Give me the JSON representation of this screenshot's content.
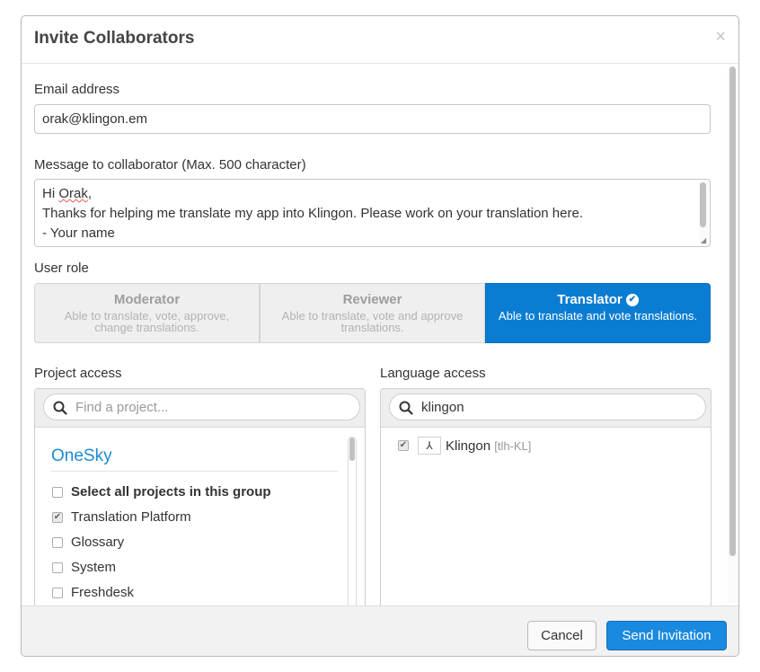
{
  "dialog": {
    "title": "Invite Collaborators",
    "close_glyph": "×"
  },
  "email": {
    "label": "Email address",
    "value": "orak@klingon.em"
  },
  "message": {
    "label": "Message to collaborator (Max. 500 character)",
    "line1_prefix": "Hi ",
    "line1_name": "Orak",
    "line1_suffix": ",",
    "line2": "Thanks for helping me translate my app into Klingon. Please work on your translation here.",
    "line3": "- Your name"
  },
  "user_role": {
    "label": "User role",
    "roles": [
      {
        "name": "Moderator",
        "desc": "Able to translate, vote, approve, change translations.",
        "selected": false
      },
      {
        "name": "Reviewer",
        "desc": "Able to translate, vote and approve translations.",
        "selected": false
      },
      {
        "name": "Translator",
        "desc": "Able to translate and vote translations.",
        "selected": true
      }
    ]
  },
  "project_access": {
    "label": "Project access",
    "search_placeholder": "Find a project...",
    "group": "OneSky",
    "items": [
      {
        "label": "Select all projects in this group",
        "checked": false
      },
      {
        "label": "Translation Platform",
        "checked": true
      },
      {
        "label": "Glossary",
        "checked": false
      },
      {
        "label": "System",
        "checked": false
      },
      {
        "label": "Freshdesk",
        "checked": false
      }
    ]
  },
  "language_access": {
    "label": "Language access",
    "search_value": "klingon",
    "languages": [
      {
        "name": "Klingon",
        "code": "[tlh-KL]",
        "checked": true
      }
    ]
  },
  "footer": {
    "cancel": "Cancel",
    "send": "Send Invitation"
  },
  "colors": {
    "accent": "#0a7dd3",
    "link": "#1b8ad3"
  },
  "icons": {
    "search": "search-icon",
    "check": "check-circle-icon",
    "close": "close-icon",
    "flag": "klingon-flag-icon"
  }
}
